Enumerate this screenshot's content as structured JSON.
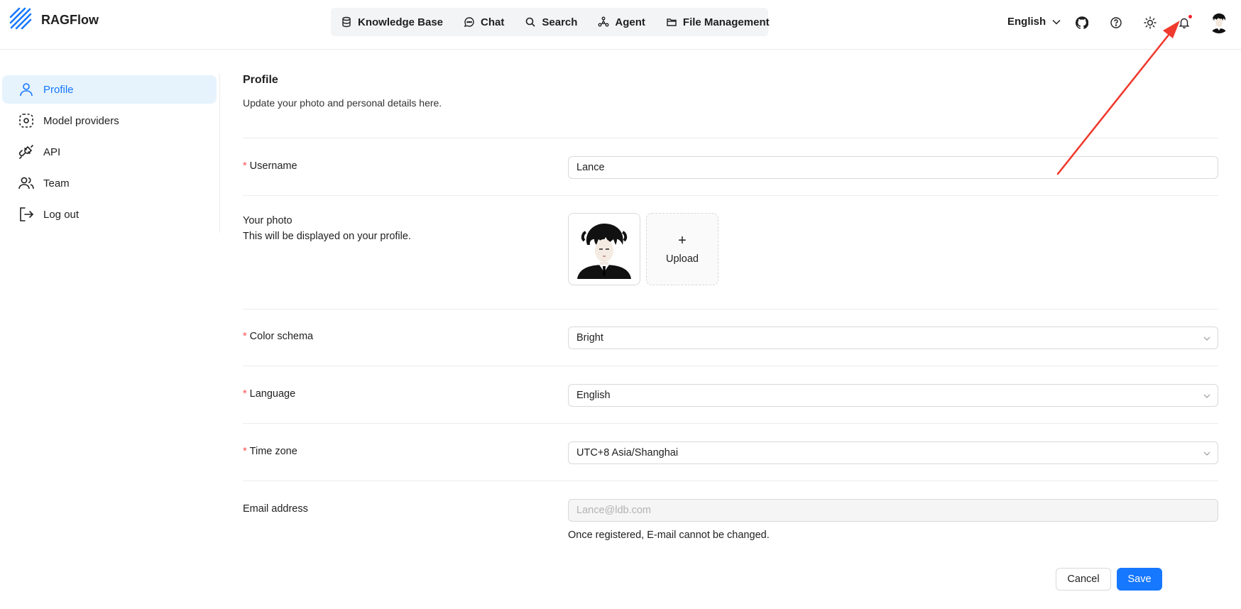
{
  "brand": {
    "name": "RAGFlow",
    "logo_icon": "ragflow-logo"
  },
  "nav": {
    "items": [
      {
        "label": "Knowledge Base",
        "icon": "database-icon"
      },
      {
        "label": "Chat",
        "icon": "chat-bubble-icon"
      },
      {
        "label": "Search",
        "icon": "search-icon"
      },
      {
        "label": "Agent",
        "icon": "agent-graph-icon"
      },
      {
        "label": "File Management",
        "icon": "folder-icon"
      }
    ]
  },
  "header_right": {
    "language": "English",
    "icons": [
      "github-icon",
      "help-icon",
      "sun-icon",
      "bell-icon"
    ],
    "notification_dot_color": "#f5222d"
  },
  "sidebar": {
    "items": [
      {
        "label": "Profile",
        "icon": "user-icon",
        "active": true
      },
      {
        "label": "Model providers",
        "icon": "model-providers-icon"
      },
      {
        "label": "API",
        "icon": "plug-icon"
      },
      {
        "label": "Team",
        "icon": "team-icon"
      },
      {
        "label": "Log out",
        "icon": "logout-icon"
      }
    ]
  },
  "profile": {
    "title": "Profile",
    "subtitle": "Update your photo and personal details here.",
    "required_marker": "*",
    "username": {
      "label": "Username",
      "value": "Lance"
    },
    "photo": {
      "label": "Your photo",
      "description": "This will be displayed on your profile.",
      "upload_plus": "+",
      "upload_label": "Upload"
    },
    "color_schema": {
      "label": "Color schema",
      "value": "Bright"
    },
    "language": {
      "label": "Language",
      "value": "English"
    },
    "timezone": {
      "label": "Time zone",
      "value": "UTC+8 Asia/Shanghai"
    },
    "email": {
      "label": "Email address",
      "placeholder": "Lance@ldb.com",
      "hint": "Once registered, E-mail cannot be changed."
    },
    "cancel_label": "Cancel",
    "save_label": "Save"
  },
  "colors": {
    "accent": "#1677ff",
    "active_bg": "#e6f3fd",
    "required": "#ff4d4f",
    "annotation_arrow": "#f03a2e"
  }
}
